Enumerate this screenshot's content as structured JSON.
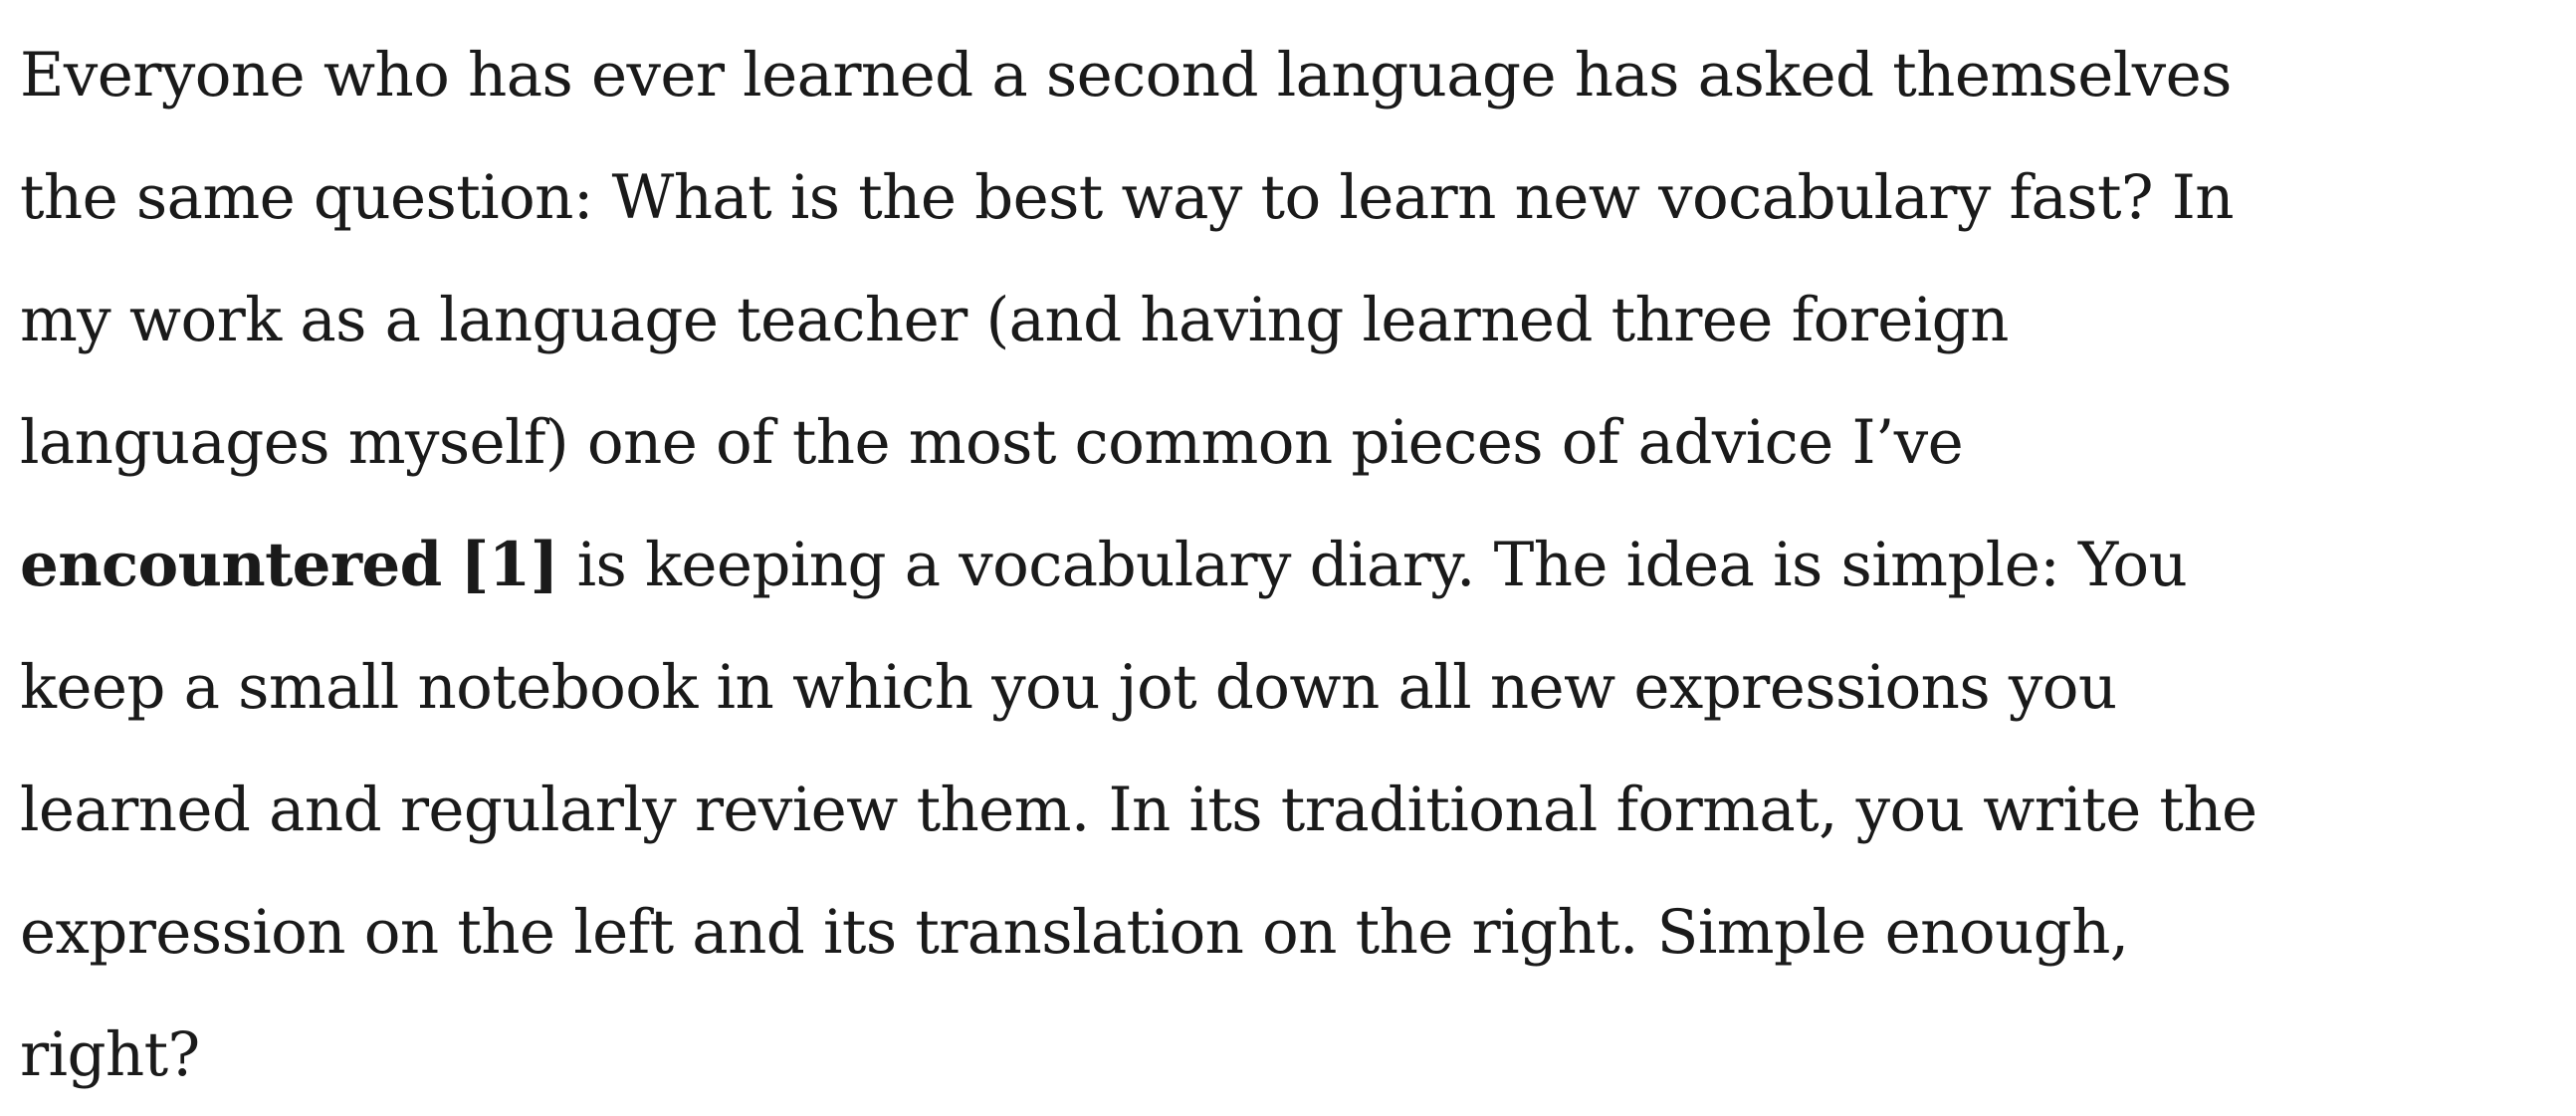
{
  "article": {
    "lines": {
      "l1": "Everyone who has ever learned a second language has asked themselves",
      "l2": "the same question: What is the best way to learn new vocabulary fast? In",
      "l3": "my work as a language teacher (and having learned three foreign",
      "l4": "languages myself) one of the most common pieces of advice I’ve",
      "l5_bold": "encountered",
      "l5_footnote": "[1]",
      "l5_rest": " is keeping a vocabulary diary. The idea is simple: You",
      "l6": "keep a small notebook in which you jot down all new expressions you",
      "l7": "learned and regularly review them. In its traditional format, you write the",
      "l8": "expression on the left and its translation on the right. Simple enough,",
      "l9": "right?"
    }
  }
}
